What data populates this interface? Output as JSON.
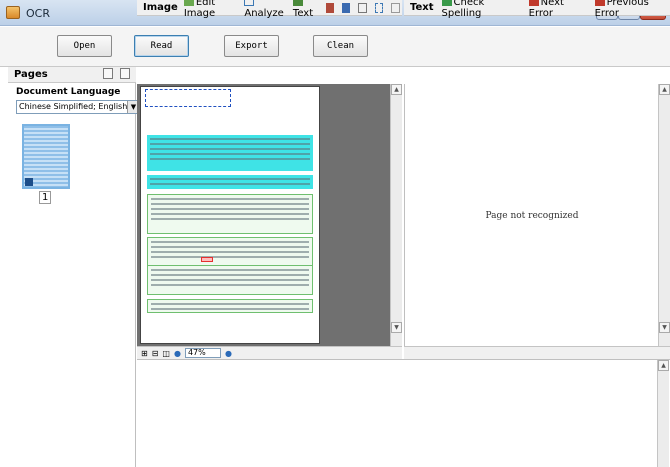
{
  "window": {
    "title": "OCR"
  },
  "toolbar": {
    "buttons": [
      {
        "label": "Open"
      },
      {
        "label": "Read"
      },
      {
        "label": "Export"
      },
      {
        "label": "Clean"
      }
    ]
  },
  "pages_panel": {
    "title": "Pages",
    "document_language_label": "Document Language",
    "language_value": "Chinese Simplified; English",
    "page_number": "1"
  },
  "image_panel": {
    "title": "Image",
    "edit_image_label": "Edit Image",
    "analyze_label": "Analyze",
    "text_label": "Text",
    "zoom_value": "47%"
  },
  "text_panel": {
    "title": "Text",
    "check_spelling_label": "Check Spelling",
    "next_error_label": "Next Error",
    "previous_error_label": "Previous Error",
    "status_message": "Page not recognized"
  },
  "colors": {
    "cyan_block": "#3fe3e6",
    "green_block": "#6fbf6f",
    "selection": "#7ab3e2"
  }
}
